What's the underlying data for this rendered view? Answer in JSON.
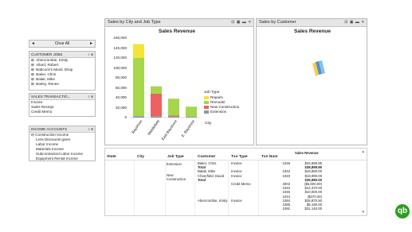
{
  "filters": {
    "clear_all_label": "Clear All",
    "customer_jobs": {
      "header": "CUSTOMER JOBS",
      "items": [
        "Abercrombie, Kristy",
        "Allard, Robert",
        "Babcock's Music Shop",
        "Baker, Chris",
        "Balak, Mike",
        "Barley, Renee"
      ]
    },
    "sales_transactions": {
      "header": "SALES TRANSACTIO...",
      "items": [
        "Invoice",
        "Sales Receipt",
        "Credit Memo"
      ]
    },
    "income_accounts": {
      "header": "INCOME ACCOUNTS",
      "items": [
        "Construction Income",
        "Less Discounts given",
        "Labor Income",
        "Materials Income",
        "Subcontracted Labor Income",
        "Equipment Rental Income"
      ]
    }
  },
  "chart_panel": {
    "title": "Sales by City and Job Type",
    "chart_title": "Sales Revenue",
    "chart_data": {
      "type": "bar",
      "stacked": true,
      "title": "Sales Revenue",
      "xlabel": "City",
      "ylabel": "",
      "ylim": [
        0,
        160000
      ],
      "yticks": [
        "0",
        "20,000",
        "40,000",
        "60,000",
        "80,000",
        "100,000",
        "120,000",
        "140,000",
        "160,000"
      ],
      "categories": [
        "Bayshore",
        "Middlefield",
        "East Bayshore",
        "E. Bayshore"
      ],
      "series": [
        {
          "name": "Extension",
          "color": "#8c96b4",
          "values": [
            3000,
            3000,
            2000,
            1500
          ]
        },
        {
          "name": "New Construction",
          "color": "#ef6060",
          "values": [
            0,
            45000,
            2000,
            0
          ]
        },
        {
          "name": "Remodel",
          "color": "#a6d64c",
          "values": [
            117000,
            15000,
            34000,
            20500
          ]
        },
        {
          "name": "Repairs",
          "color": "#f2e43a",
          "values": [
            28000,
            0,
            0,
            0
          ]
        }
      ],
      "legend_title": "Job Type",
      "legend_entries": [
        "Repairs",
        "Remodel",
        "New Construction",
        "Extension"
      ],
      "legend_colors": [
        "#f2e43a",
        "#a6d64c",
        "#ef6060",
        "#8c96b4"
      ],
      "legend_placement": "right",
      "grid": false
    }
  },
  "customer_panel": {
    "title": "Sales by Customer",
    "chart_title": "Sales Revenue"
  },
  "table": {
    "headers": [
      "State",
      "City",
      "Job Type",
      "Customer",
      "Txn Type",
      "Txn Num",
      "Sales Revenue"
    ],
    "job_types": [
      "Extension",
      "New Construction"
    ],
    "rows": [
      {
        "customer": "Baker, Chris",
        "txn_type": "Invoice",
        "txn_num": "1049",
        "revenue": "$34,895.85",
        "bold": false
      },
      {
        "customer": "Total",
        "txn_type": "",
        "txn_num": "",
        "revenue": "$38,898.85",
        "bold": true
      },
      {
        "customer": "Balak, Mike",
        "txn_type": "Invoice",
        "txn_num": "1022",
        "revenue": "$19,990.00",
        "bold": false
      },
      {
        "customer": "Cheerfield, David",
        "txn_type": "Invoice",
        "txn_num": "1023",
        "revenue": "$19,990.00",
        "bold": false
      },
      {
        "customer": "Total",
        "txn_type": "",
        "txn_num": "",
        "revenue": "$39,980.00",
        "bold": true
      },
      {
        "customer": "",
        "txn_type": "Credit Memo",
        "txn_num": "4002",
        "revenue": "($6,600.00)",
        "bold": false
      },
      {
        "customer": "",
        "txn_type": "",
        "txn_num": "1043",
        "revenue": "$12,370.00",
        "bold": false
      },
      {
        "customer": "",
        "txn_type": "",
        "txn_num": "1045",
        "revenue": "$10,000.00",
        "bold": false
      },
      {
        "customer": "",
        "txn_type": "",
        "txn_num": "1044",
        "revenue": "($370.20)",
        "bold": false
      },
      {
        "customer": "Abercrombie, Kristy",
        "txn_type": "Invoice",
        "txn_num": "1084",
        "revenue": "$28,870.50",
        "bold": false
      },
      {
        "customer": "",
        "txn_type": "",
        "txn_num": "1085",
        "revenue": "$5,190.00",
        "bold": false
      },
      {
        "customer": "",
        "txn_type": "",
        "txn_num": "1091",
        "revenue": "$31,140.00",
        "bold": false
      }
    ]
  },
  "branding": {
    "logo_color": "#2ca01c",
    "logo_icon": "quickbooks-logo"
  }
}
